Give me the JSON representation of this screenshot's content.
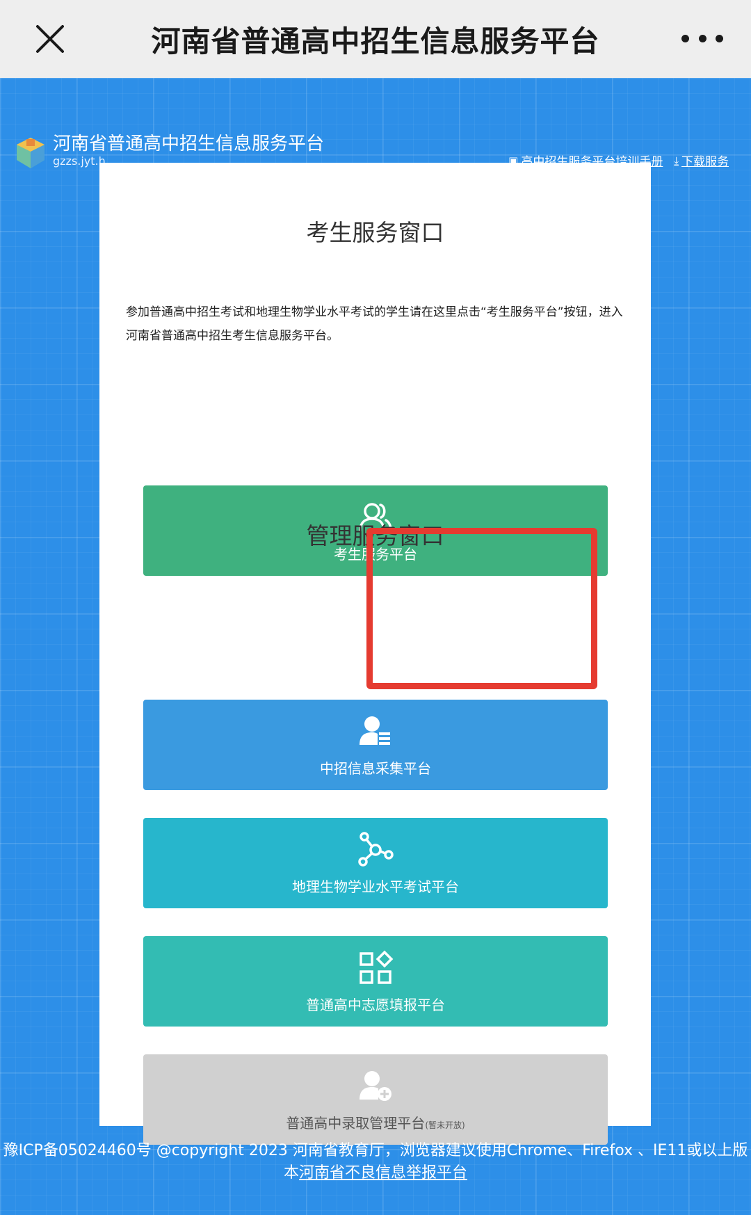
{
  "topbar": {
    "title": "河南省普通高中招生信息服务平台",
    "close_icon": "close-icon",
    "more_icon": "more-icon"
  },
  "site": {
    "name": "河南省普通高中招生信息服务平台",
    "url": "gzzs.jyt.h",
    "links": [
      {
        "label": "高中招生服务平台培训手册",
        "icon": "manual-icon"
      },
      {
        "label": "下载服务",
        "icon": "download-icon"
      }
    ]
  },
  "card": {
    "student_title": "考生服务窗口",
    "student_desc": "参加普通高中招生考试和地理生物学业水平考试的学生请在这里点击“考生服务平台”按钮，进入河南省普通高中招生考生信息服务平台。",
    "student_button": "考生服务平台",
    "admin_title": "管理服务窗口",
    "buttons": [
      {
        "label": "中招信息采集平台",
        "icon": "user-list-icon"
      },
      {
        "label": "地理生物学业水平考试平台",
        "icon": "network-icon"
      },
      {
        "label": "普通高中志愿填报平台",
        "icon": "apps-grid-icon"
      },
      {
        "label": "普通高中录取管理平台",
        "note": "(暂未开放)",
        "icon": "user-add-icon"
      }
    ]
  },
  "footer": {
    "line1": "豫ICP备05024460号 @copyright 2023 河南省教育厅，浏览器建议使用Chrome、Firefox 、IE11或以上版",
    "line2_prefix": "本",
    "line2_link": "河南省不良信息举报平台"
  },
  "colors": {
    "page_bg": "#2d8fe8",
    "green": "#3fb17f",
    "blue": "#3a9ae0",
    "cyan": "#27b6cc",
    "teal": "#33bcb3",
    "gray": "#d0d0d0",
    "highlight": "#e53b30"
  }
}
